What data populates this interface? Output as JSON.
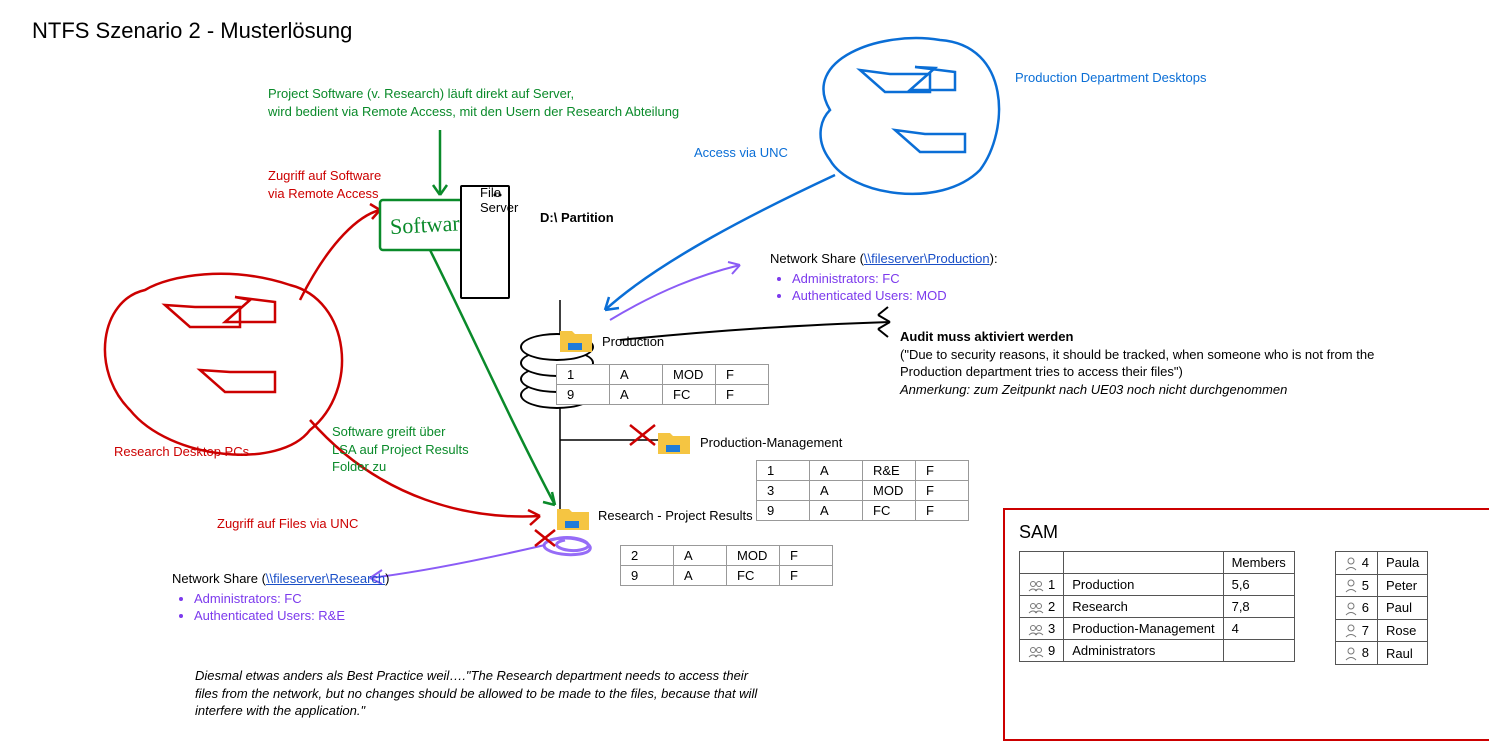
{
  "title": "NTFS Szenario 2 - Musterlösung",
  "labels": {
    "research_pcs": "Research Desktop PCs",
    "prod_pcs": "Production Department Desktops",
    "remote_access": "Zugriff auf Software\nvia Remote Access",
    "files_unc": "Zugriff auf Files via UNC",
    "access_unc": "Access via UNC",
    "proj_software": "Project Software (v. Research) läuft direkt auf Server,\nwird bedient via Remote Access, mit den Usern der Research Abteilung",
    "software_lsa": "Software greift über\nLSA auf Project Results\nFolder zu",
    "file_server": "File\nServer",
    "software_box": "Software",
    "partition": "D:\\ Partition",
    "folder_prod": "Production",
    "folder_prodmgmt": "Production-Management",
    "folder_research": "Research - Project Results",
    "share_prod_title": "Network Share (",
    "share_prod_unc": "\\\\fileserver\\Production",
    "share_prod_end": "):",
    "share_prod_l1": "Administrators: FC",
    "share_prod_l2": "Authenticated Users: MOD",
    "share_res_title": "Network Share (",
    "share_res_unc": "\\\\fileserver\\Research",
    "share_res_end": ")",
    "share_res_l1": "Administrators: FC",
    "share_res_l2": "Authenticated Users: R&E",
    "audit_title": "Audit muss aktiviert werden",
    "audit_body": "(\"Due to security reasons, it should be tracked, when someone who is not from the Production department tries to access their files\")",
    "audit_note": "Anmerkung: zum Zeitpunkt nach UE03 noch nicht durchgenommen",
    "bestpractice": "Diesmal etwas anders als Best Practice weil….\"The Research department needs to access their files from the network, but no changes should be allowed to be made to the files, because that will interfere with the application.\"",
    "sam_title": "SAM",
    "members_hdr": "Members"
  },
  "tables": {
    "production": [
      [
        "1",
        "A",
        "MOD",
        "F"
      ],
      [
        "9",
        "A",
        "FC",
        "F"
      ]
    ],
    "prodmgmt": [
      [
        "1",
        "A",
        "R&E",
        "F"
      ],
      [
        "3",
        "A",
        "MOD",
        "F"
      ],
      [
        "9",
        "A",
        "FC",
        "F"
      ]
    ],
    "research": [
      [
        "2",
        "A",
        "MOD",
        "F"
      ],
      [
        "9",
        "A",
        "FC",
        "F"
      ]
    ]
  },
  "sam": {
    "groups": [
      {
        "id": "1",
        "name": "Production",
        "members": "5,6"
      },
      {
        "id": "2",
        "name": "Research",
        "members": "7,8"
      },
      {
        "id": "3",
        "name": "Production-Management",
        "members": "4"
      },
      {
        "id": "9",
        "name": "Administrators",
        "members": ""
      }
    ],
    "users": [
      {
        "id": "4",
        "name": "Paula"
      },
      {
        "id": "5",
        "name": "Peter"
      },
      {
        "id": "6",
        "name": "Paul"
      },
      {
        "id": "7",
        "name": "Rose"
      },
      {
        "id": "8",
        "name": "Raul"
      }
    ]
  }
}
